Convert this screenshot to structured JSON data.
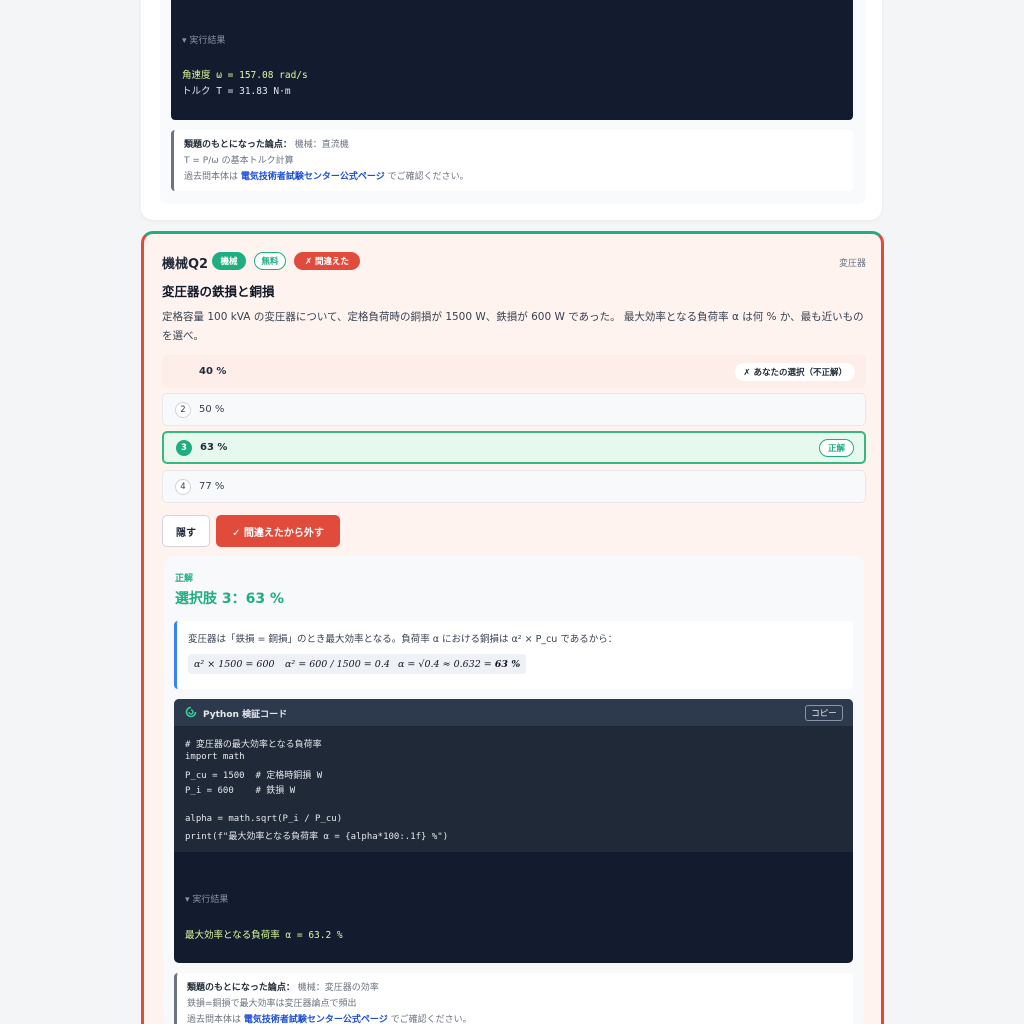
{
  "prev": {
    "result_head": "▾ 実行結果",
    "result_lines": [
      "角速度 ω = 157.08 rad/s",
      "トルク T = 31.83 N·m"
    ],
    "source_label": "類題のもとになった論点：",
    "source_topic": "機械：直流機",
    "source_detail": "T = P/ω の基本トルク計算",
    "source_pre": "過去問本体は",
    "source_link": "電気技術者試験センター公式ページ",
    "source_post": "でご確認ください。"
  },
  "question": {
    "title": "機械Q2",
    "badges": [
      "機械",
      "無料",
      "✗ 間違えた"
    ],
    "category": "変圧器",
    "heading": "変圧器の鉄損と銅損",
    "body": "定格容量 100 kVA の変圧器について、定格負荷時の銅損が 1500 W、鉄損が 600 W であった。 最大効率となる負荷率 α は何 % か、最も近いものを選べ。",
    "choices": [
      {
        "num": "1",
        "text": "40 %",
        "tag": "✗ あなたの選択（不正解）"
      },
      {
        "num": "2",
        "text": "50 %",
        "tag": ""
      },
      {
        "num": "3",
        "text": "63 %",
        "tag": "正解"
      },
      {
        "num": "4",
        "text": "77 %",
        "tag": ""
      }
    ],
    "hide_button": "隠す",
    "unmark_button": "✓ 間違えたから外す"
  },
  "answer": {
    "label": "正解",
    "value": "選択肢 3：63 %",
    "explanation": "変圧器は「鉄損 = 銅損」のとき最大効率となる。負荷率 α における銅損は α² × P_cu であるから：",
    "formulas": [
      "α² × 1500 = 600",
      "α² = 600 / 1500 = 0.4",
      "α = √0.4 ≈ 0.632 ="
    ],
    "formula_result": "63 %"
  },
  "code": {
    "title": "Python 検証コード",
    "copy": "コピー",
    "lines": [
      "# 変圧器の最大効率となる負荷率",
      "import math",
      "P_cu = 1500  # 定格時銅損 W",
      "P_i = 600    # 鉄損 W",
      "",
      "alpha = math.sqrt(P_i / P_cu)",
      "print(f\"最大効率となる負荷率 α = {alpha*100:.1f} %\")"
    ],
    "result_head": "▾ 実行結果",
    "result_line": "最大効率となる負荷率 α = 63.2 %"
  },
  "source2": {
    "label": "類題のもとになった論点：",
    "topic": "機械：変圧器の効率",
    "detail": "鉄損=銅損で最大効率は変圧器論点で頻出",
    "pre": "過去問本体は",
    "link": "電気技術者試験センター公式ページ",
    "post": "でご確認ください。"
  }
}
